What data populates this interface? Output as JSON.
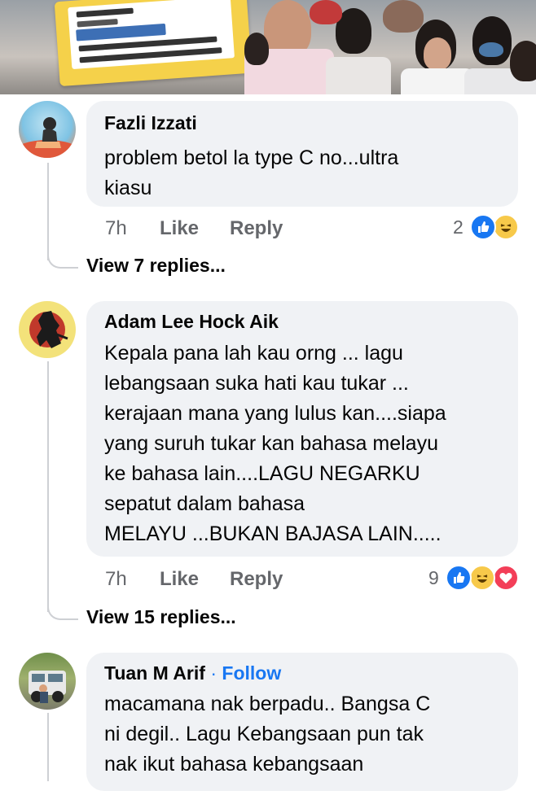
{
  "comments": [
    {
      "author": "Fazli Izzati",
      "lines": [
        "problem betol la type C no...ultra",
        "kiasu"
      ],
      "time": "7h",
      "like_label": "Like",
      "reply_label": "Reply",
      "reaction_count": "2",
      "reactions": [
        "like-icon",
        "haha-icon"
      ],
      "view_replies": "View 7 replies..."
    },
    {
      "author": "Adam Lee Hock Aik",
      "lines": [
        "Kepala pana lah kau orng ... lagu",
        "lebangsaan suka hati kau tukar ...",
        "kerajaan mana yang lulus kan....siapa",
        "yang suruh tukar kan bahasa melayu",
        "ke bahasa lain....LAGU NEGARKU",
        "sepatut dalam bahasa",
        "MELAYU ...BUKAN BAJASA LAIN....."
      ],
      "time": "7h",
      "like_label": "Like",
      "reply_label": "Reply",
      "reaction_count": "9",
      "reactions": [
        "like-icon",
        "haha-icon",
        "love-icon"
      ],
      "view_replies": "View 15 replies..."
    },
    {
      "author": "Tuan M Arif",
      "separator": " · ",
      "follow_label": "Follow",
      "lines": [
        "macamana nak berpadu.. Bangsa C",
        "ni degil.. Lagu Kebangsaan pun tak",
        "nak ikut bahasa kebangsaan"
      ]
    }
  ],
  "colors": {
    "bubble": "#f0f2f5",
    "text": "#050505",
    "meta": "#65676b",
    "link_blue": "#1877f2",
    "like_blue": "#1877f2",
    "haha_yellow": "#f7c94a",
    "love_red": "#f33e58"
  }
}
